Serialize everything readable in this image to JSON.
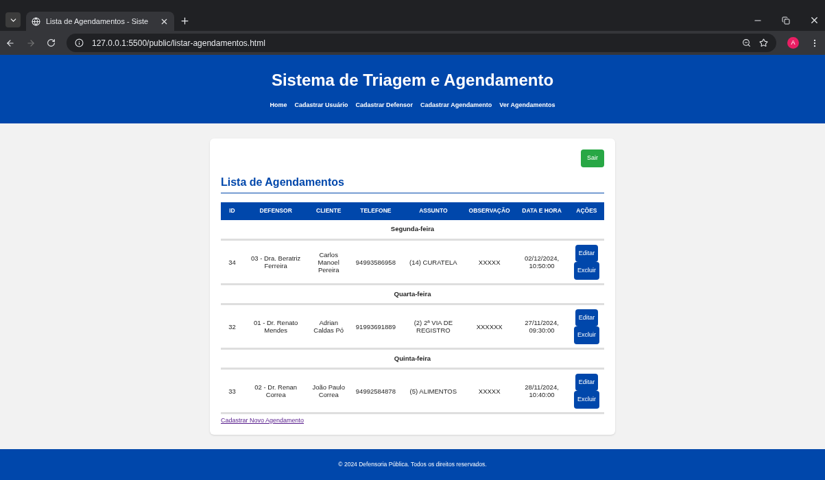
{
  "browser": {
    "tab_title": "Lista de Agendamentos - Siste",
    "url": "127.0.0.1:5500/public/listar-agendamentos.html",
    "profile_initial": "A"
  },
  "header": {
    "title": "Sistema de Triagem e Agendamento",
    "nav": [
      "Home",
      "Cadastrar Usuário",
      "Cadastrar Defensor",
      "Cadastrar Agendamento",
      "Ver Agendamentos"
    ]
  },
  "card": {
    "logout_button": "Sair",
    "heading": "Lista de Agendamentos",
    "table": {
      "columns": [
        "ID",
        "DEFENSOR",
        "CLIENTE",
        "TELEFONE",
        "ASSUNTO",
        "OBSERVAÇÃO",
        "DATA E HORA",
        "AÇÕES"
      ],
      "rows": [
        {
          "kind": "group",
          "label": "Segunda-feira"
        },
        {
          "kind": "record",
          "cells": [
            "34",
            "03 - Dra. Beratriz Ferreira",
            "Carlos Manoel Pereira",
            "94993586958",
            "(14) CURATELA",
            "XXXXX",
            "02/12/2024, 10:50:00"
          ],
          "actions": [
            "Editar",
            "Excluir"
          ]
        },
        {
          "kind": "group",
          "label": "Quarta-feira"
        },
        {
          "kind": "record",
          "cells": [
            "32",
            "01 - Dr. Renato Mendes",
            "Adrian Caldas Pó",
            "91993691889",
            "(2) 2ª VIA DE REGISTRO",
            "XXXXXX",
            "27/11/2024, 09:30:00"
          ],
          "actions": [
            "Editar",
            "Excluir"
          ]
        },
        {
          "kind": "group",
          "label": "Quinta-feira"
        },
        {
          "kind": "record",
          "cells": [
            "33",
            "02 - Dr. Renan Correa",
            "João Paulo Correa",
            "94992584878",
            "(5) ALIMENTOS",
            "XXXXX",
            "28/11/2024, 10:40:00"
          ],
          "actions": [
            "Editar",
            "Excluir"
          ]
        }
      ]
    },
    "new_link": "Cadastrar Novo Agendamento"
  },
  "footer": "© 2024 Defensoria Pública. Todos os direitos reservados."
}
